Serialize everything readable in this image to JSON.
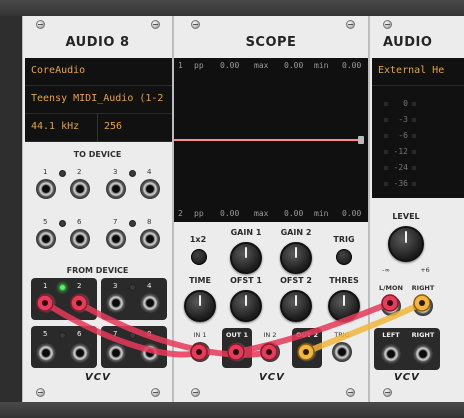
{
  "modules": {
    "audio8": {
      "title": "AUDIO 8",
      "driver": "CoreAudio",
      "device": "Teensy MIDI_Audio (1-2",
      "sample_rate": "44.1 kHz",
      "block_size": "256",
      "to_device_label": "TO DEVICE",
      "from_device_label": "FROM DEVICE",
      "to_ports": [
        "1",
        "2",
        "3",
        "4",
        "5",
        "6",
        "7",
        "8"
      ],
      "from_ports": [
        "1",
        "2",
        "3",
        "4",
        "5",
        "6",
        "7",
        "8"
      ],
      "brand": "VCV"
    },
    "scope": {
      "title": "SCOPE",
      "top_stats": {
        "channel": "1",
        "pp_label": "pp",
        "pp": "0.00",
        "max_label": "max",
        "max": "0.00",
        "min_label": "min",
        "min": "0.00"
      },
      "bottom_stats": {
        "channel": "2",
        "pp_label": "pp",
        "pp": "0.00",
        "max_label": "max",
        "max": "0.00",
        "min_label": "min",
        "min": "0.00"
      },
      "trace_color": "#ff8a8a",
      "mode_label": "1x2",
      "gain1_label": "GAIN 1",
      "gain2_label": "GAIN 2",
      "trig_label": "TRIG",
      "time_label": "TIME",
      "ofst1_label": "OFST 1",
      "ofst2_label": "OFST 2",
      "thres_label": "THRES",
      "in1_label": "IN 1",
      "out1_label": "OUT 1",
      "in2_label": "IN 2",
      "out2_label": "OUT 2",
      "trig_in_label": "TRIG",
      "brand": "VCV"
    },
    "audio2": {
      "title": "AUDIO",
      "device": "External He",
      "meter_labels": [
        "0",
        "-3",
        "-6",
        "-12",
        "-24",
        "-36"
      ],
      "level_label": "LEVEL",
      "level_min": "-∞",
      "level_max": "+6",
      "lmon_label": "L/MON",
      "right_label": "RIGHT",
      "left_out_label": "LEFT",
      "right_out_label": "RIGHT",
      "brand": "VCV"
    }
  },
  "cables": {
    "red": "#e83a5a",
    "yellow": "#f2b63a"
  }
}
